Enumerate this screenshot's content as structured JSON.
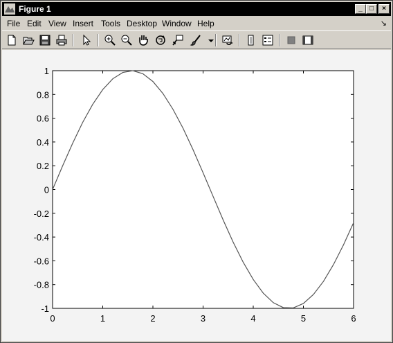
{
  "window": {
    "title": "Figure 1",
    "minimize": "_",
    "maximize": "□",
    "close": "×"
  },
  "menu": {
    "items": [
      "File",
      "Edit",
      "View",
      "Insert",
      "Tools",
      "Desktop",
      "Window",
      "Help"
    ],
    "end_glyph": "↘"
  },
  "toolbar": {
    "buttons": [
      "new-figure-icon",
      "open-file-icon",
      "save-icon",
      "print-icon",
      "pointer-icon",
      "zoom-in-icon",
      "zoom-out-icon",
      "pan-hand-icon",
      "rotate-3d-icon",
      "data-cursor-icon",
      "brush-icon",
      "link-plot-icon",
      "colorbar-icon",
      "legend-icon",
      "hide-plot-tools-icon",
      "show-plot-tools-icon"
    ]
  },
  "chart_data": {
    "type": "line",
    "title": "",
    "xlabel": "",
    "ylabel": "",
    "xlim": [
      0,
      6
    ],
    "ylim": [
      -1,
      1
    ],
    "xticks": [
      0,
      1,
      2,
      3,
      4,
      5,
      6
    ],
    "yticks": [
      -1,
      -0.8,
      -0.6,
      -0.4,
      -0.2,
      0,
      0.2,
      0.4,
      0.6,
      0.8,
      1
    ],
    "grid": false,
    "color": "#555555",
    "series": [
      {
        "x": [
          0,
          0.2,
          0.4,
          0.6,
          0.8,
          1.0,
          1.2,
          1.4,
          1.6,
          1.8,
          2.0,
          2.2,
          2.4,
          2.6,
          2.8,
          3.0,
          3.2,
          3.4,
          3.6,
          3.8,
          4.0,
          4.2,
          4.4,
          4.6,
          4.8,
          5.0,
          5.2,
          5.4,
          5.6,
          5.8,
          6.0
        ],
        "y": [
          0,
          0.199,
          0.389,
          0.565,
          0.717,
          0.841,
          0.932,
          0.985,
          1.0,
          0.974,
          0.909,
          0.808,
          0.675,
          0.516,
          0.335,
          0.141,
          -0.058,
          -0.256,
          -0.443,
          -0.612,
          -0.757,
          -0.872,
          -0.952,
          -0.994,
          -0.996,
          -0.959,
          -0.883,
          -0.773,
          -0.631,
          -0.465,
          -0.279
        ]
      }
    ]
  }
}
